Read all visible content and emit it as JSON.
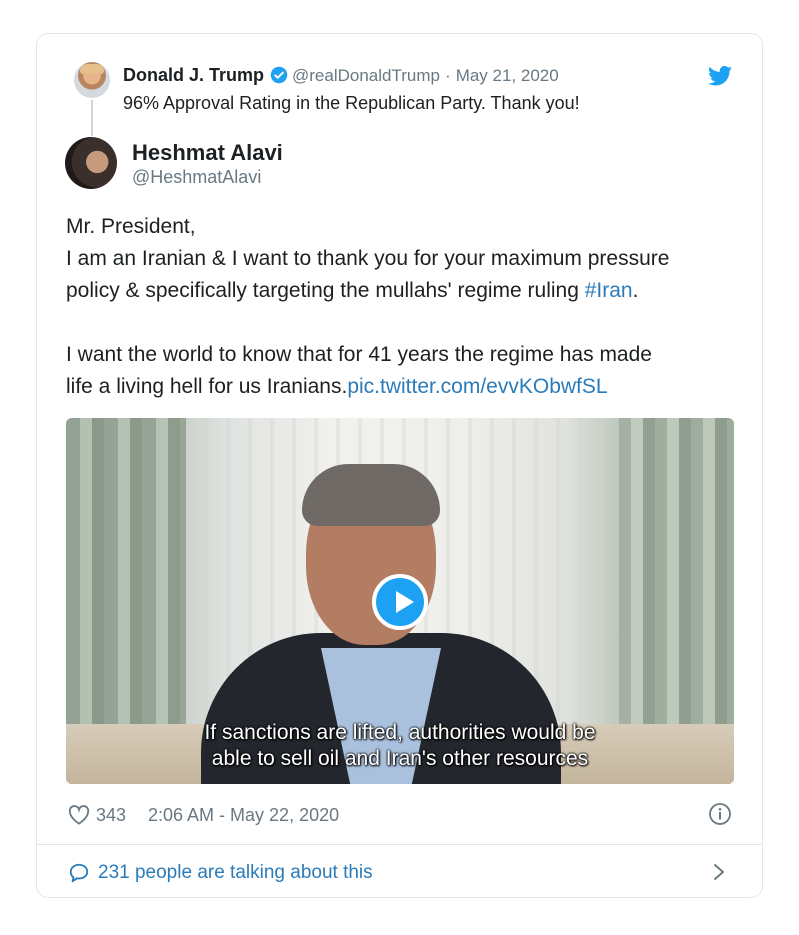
{
  "parent_tweet": {
    "name": "Donald J. Trump",
    "handle": "@realDonaldTrump",
    "separator": "·",
    "date": "May 21, 2020",
    "text": "96% Approval Rating in the Republican Party. Thank you!"
  },
  "tweet": {
    "name": "Heshmat Alavi",
    "handle": "@HeshmatAlavi",
    "line1": "Mr. President,",
    "line2": "I am an Iranian & I want to thank you for your maximum pressure",
    "line3_prefix": "policy & specifically targeting the mullahs' regime ruling ",
    "hashtag": "#Iran",
    "line3_suffix": ".",
    "line4": "I want the world to know that for 41 years the regime has made",
    "line5_prefix": "life a living hell for us Iranians.",
    "pic_link": "pic.twitter.com/evvKObwfSL"
  },
  "video": {
    "subtitle_line1": "If sanctions are lifted, authorities would be",
    "subtitle_line2": "able to sell oil and Iran's other resources"
  },
  "footer": {
    "likes": "343",
    "timestamp": "2:06 AM - May 22, 2020",
    "talking": "231 people are talking about this"
  },
  "colors": {
    "link": "#2b7bb9",
    "twitter_blue": "#1da1f2",
    "muted": "#697882",
    "border": "#e1e8ed"
  },
  "icons": [
    "verified-icon",
    "twitter-bird-icon",
    "play-icon",
    "heart-icon",
    "info-icon",
    "speech-bubble-icon",
    "chevron-right-icon"
  ]
}
